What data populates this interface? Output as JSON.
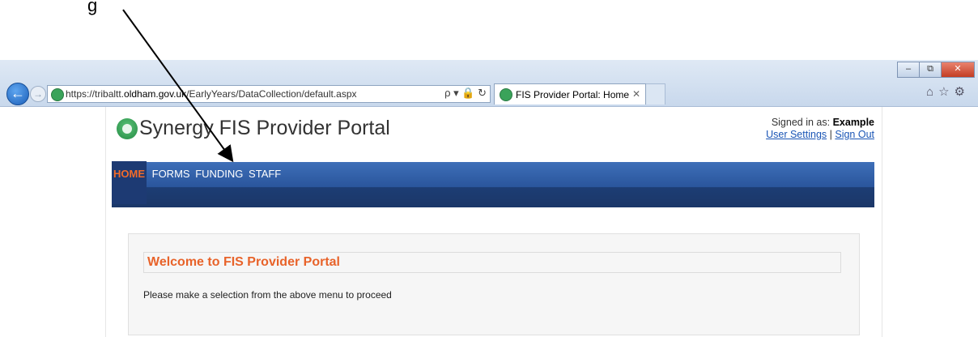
{
  "instruction": "g",
  "browser": {
    "url_prefix": "https://tribaltt.",
    "url_host": "oldham.gov.uk",
    "url_path": "/EarlyYears/DataCollection/default.aspx",
    "addr_tools": "ρ ▾ 🔒 ↻",
    "tab_title": "FIS Provider Portal: Home",
    "tab_close": "✕",
    "back_icon": "←",
    "forward_icon": "→",
    "win_minimize": "–",
    "win_restore": "⧉",
    "win_close": "✕",
    "right_icons": "⌂☆⚙"
  },
  "header": {
    "logo_text": "Synergy FIS Provider Portal",
    "signed_in_label": "Signed in as:",
    "user_name": "Example",
    "user_settings": "User Settings",
    "separator": "|",
    "sign_out": "Sign Out"
  },
  "nav": {
    "items": [
      {
        "label": "HOME",
        "active": true
      },
      {
        "label": "FORMS"
      },
      {
        "label": "FUNDING"
      },
      {
        "label": "STAFF"
      }
    ]
  },
  "main": {
    "welcome_title": "Welcome to FIS Provider Portal",
    "proceed_text": "Please make a selection from the above menu to proceed"
  },
  "colors": {
    "accent_orange": "#e8632a",
    "nav_blue": "#2a559c",
    "link_blue": "#1a55b5"
  }
}
